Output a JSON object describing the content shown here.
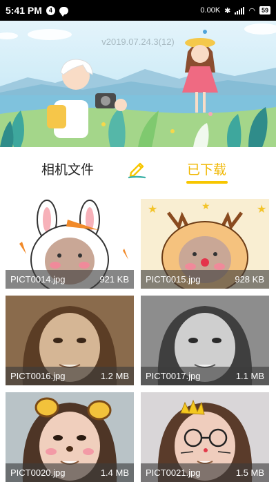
{
  "status_bar": {
    "time": "5:41 PM",
    "notification_count": "4",
    "network_speed": "0.00K",
    "battery": "59"
  },
  "banner": {
    "version": "v2019.07.24.3(12)"
  },
  "tabs": {
    "camera_files": "相机文件",
    "downloaded": "已下载",
    "active": "downloaded",
    "accent_color": "#f7c600"
  },
  "photos": [
    {
      "name": "PICT0014.jpg",
      "size": "921 KB",
      "filter": "bunny-ears"
    },
    {
      "name": "PICT0015.jpg",
      "size": "928 KB",
      "filter": "reindeer"
    },
    {
      "name": "PICT0016.jpg",
      "size": "1.2 MB",
      "filter": "sepia"
    },
    {
      "name": "PICT0017.jpg",
      "size": "1.1 MB",
      "filter": "grayscale"
    },
    {
      "name": "PICT0020.jpg",
      "size": "1.4 MB",
      "filter": "bear-ears"
    },
    {
      "name": "PICT0021.jpg",
      "size": "1.5 MB",
      "filter": "crown-glasses"
    }
  ]
}
